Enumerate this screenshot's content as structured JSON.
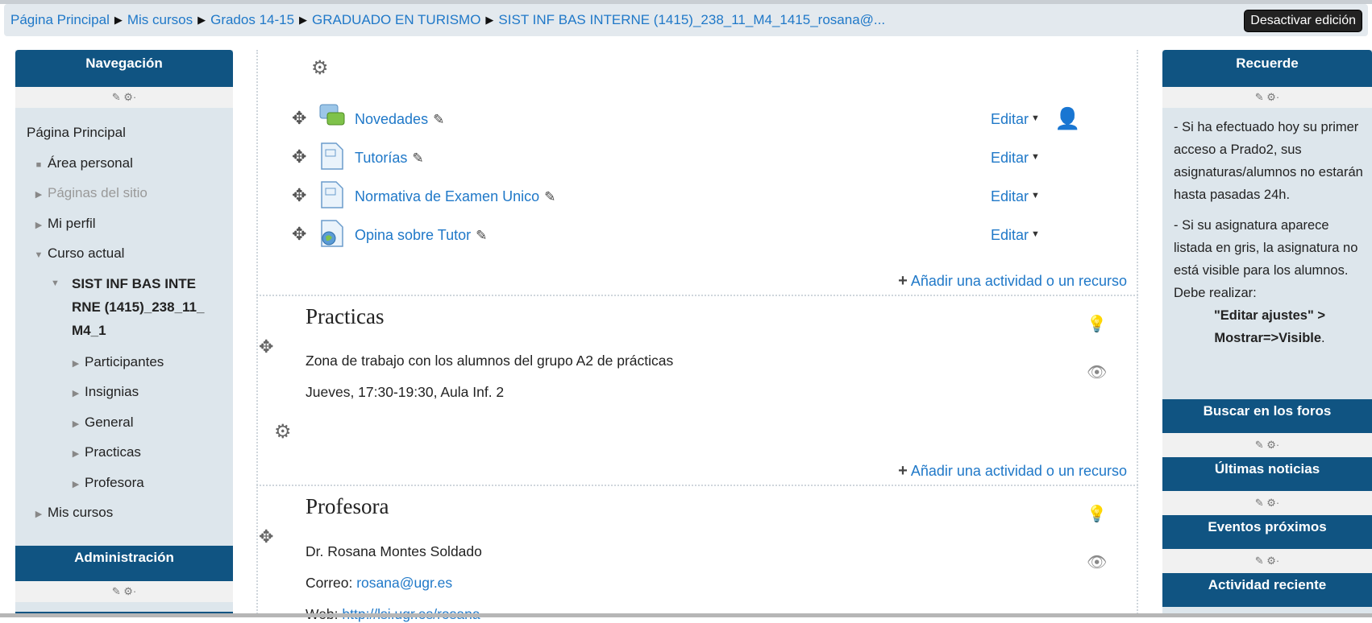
{
  "breadcrumb": {
    "items": [
      "Página Principal",
      "Mis cursos",
      "Grados 14-15",
      "GRADUADO EN TURISMO",
      "SIST INF BAS INTERNE (1415)_238_11_M4_1415_rosana@..."
    ],
    "separator": "▶"
  },
  "edit_toggle_label": "Desactivar edición",
  "navigation": {
    "title": "Navegación",
    "controls": "✎ ⚙·",
    "home": "Página Principal",
    "items": [
      {
        "label": "Área personal"
      },
      {
        "label": "Páginas del sitio"
      },
      {
        "label": "Mi perfil"
      },
      {
        "label": "Curso actual"
      }
    ],
    "course": "SIST INF BAS INTERNE (1415)_238_11_M4_1",
    "course_items": [
      "Participantes",
      "Insignias",
      "General",
      "Practicas",
      "Profesora"
    ],
    "my_courses": "Mis cursos"
  },
  "administration": {
    "title": "Administración",
    "controls": "✎ ⚙·"
  },
  "main": {
    "activities": [
      {
        "name": "Novedades",
        "edit": "Editar",
        "icon": "forum-icon"
      },
      {
        "name": "Tutorías",
        "edit": "Editar",
        "icon": "page-icon"
      },
      {
        "name": "Normativa de Examen Unico",
        "edit": "Editar",
        "icon": "page-icon"
      },
      {
        "name": "Opina sobre Tutor",
        "edit": "Editar",
        "icon": "feedback-icon"
      }
    ],
    "add_activity_label": "Añadir una actividad o un recurso",
    "sections": [
      {
        "title": "Practicas",
        "lines": [
          "Zona de trabajo con los alumnos del grupo A2 de prácticas",
          "Jueves, 17:30-19:30, Aula Inf. 2"
        ]
      },
      {
        "title": "Profesora",
        "name_line": "Dr. Rosana Montes Soldado",
        "email_prefix": "Correo: ",
        "email": "rosana@ugr.es",
        "web_prefix": "Web: ",
        "web": "http://lsi.ugr.es/rosana"
      }
    ]
  },
  "reminder": {
    "title": "Recuerde",
    "controls": "✎ ⚙·",
    "p1": "- Si ha efectuado hoy su primer acceso a Prado2, sus asignaturas/alumnos no estarán hasta pasadas 24h.",
    "p2": "- Si su asignatura aparece listada en gris, la asignatura no está visible para los alumnos. Debe realizar:",
    "p2_bold1": "\"Editar ajustes\" >",
    "p2_bold2": "Mostrar=>Visible",
    "p2_end": "."
  },
  "right_blocks": [
    {
      "title": "Buscar en los foros",
      "controls": "✎ ⚙·"
    },
    {
      "title": "Últimas noticias",
      "controls": "✎ ⚙·"
    },
    {
      "title": "Eventos próximos",
      "controls": "✎ ⚙·"
    },
    {
      "title": "Actividad reciente"
    }
  ],
  "colors": {
    "header": "#105482",
    "link": "#1f78c8",
    "block_bg": "#dde6ec"
  }
}
